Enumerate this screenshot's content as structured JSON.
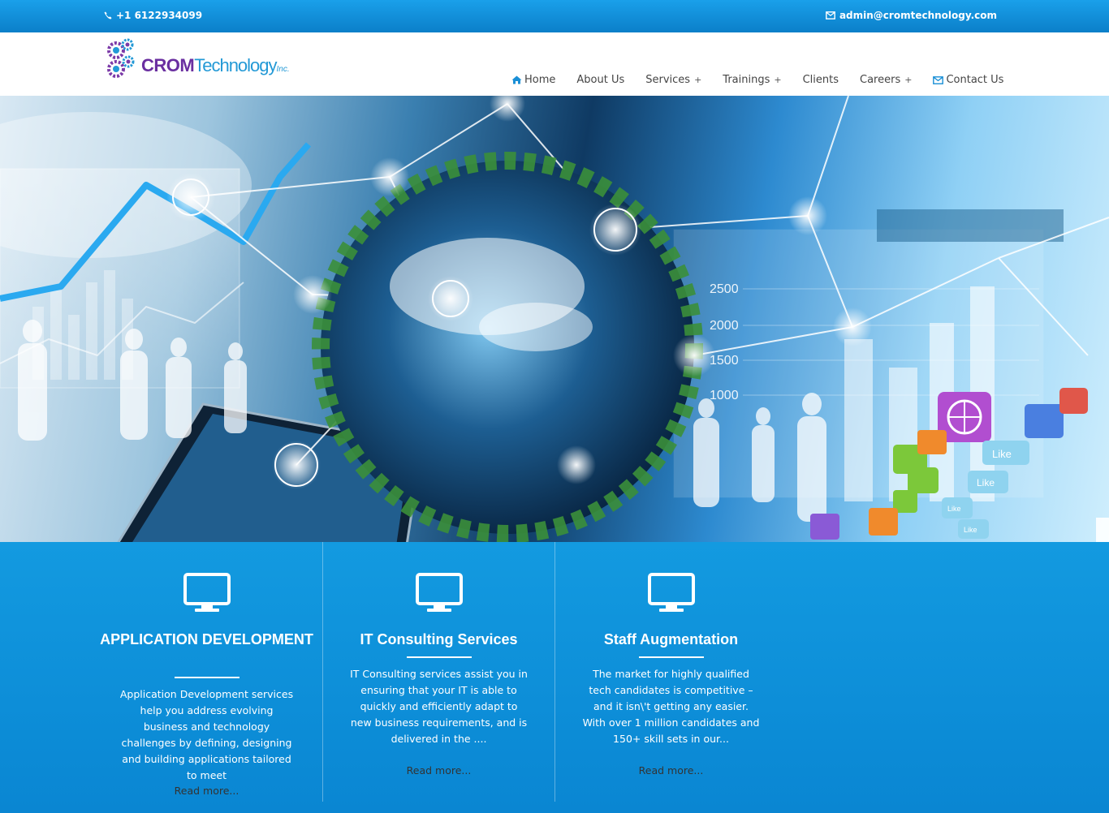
{
  "topbar": {
    "phone": "+1 6122934099",
    "email": "admin@cromtechnology.com"
  },
  "logo": {
    "crom": "CROM",
    "technology": "Technology",
    "inc": "Inc."
  },
  "nav": {
    "items": [
      {
        "label": "Home",
        "icon": "home-icon"
      },
      {
        "label": "About Us"
      },
      {
        "label": "Services",
        "plus": "+"
      },
      {
        "label": "Trainings",
        "plus": "+"
      },
      {
        "label": "Clients"
      },
      {
        "label": "Careers",
        "plus": "+"
      },
      {
        "label": "Contact Us",
        "icon": "envelope-icon"
      }
    ]
  },
  "hero": {
    "chart_ticks": [
      "2500",
      "2000",
      "1500",
      "1000"
    ],
    "app_labels": [
      "Like",
      "Like",
      "Like",
      "Like"
    ]
  },
  "features": [
    {
      "title": "APPLICATION DEVELOPMENT",
      "text": "Application Development services help you address evolving business and technology challenges by defining, designing and building applications tailored to meet",
      "more": "Read more..."
    },
    {
      "title": "IT Consulting Services",
      "text": "IT Consulting services assist you in ensuring that your IT is able to quickly and efficiently adapt to new business requirements, and is delivered in the ....",
      "more": "Read more..."
    },
    {
      "title": "Staff Augmentation",
      "text": "The market for highly qualified tech candidates is competitive – and it isn\\'t getting any easier. With over 1 million candidates and 150+ skill sets in our...",
      "more": "Read more..."
    }
  ],
  "colors": {
    "topbar": "#0b7fc9",
    "feature_bg": "#0d8ed8",
    "logo_purple": "#6a2fa0",
    "logo_blue": "#2399d6"
  }
}
